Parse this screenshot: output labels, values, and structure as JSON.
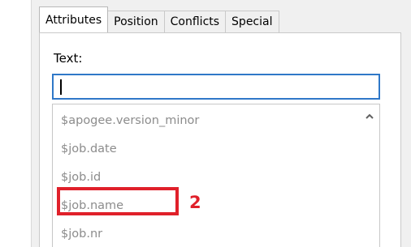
{
  "tabs": [
    {
      "label": "Attributes"
    },
    {
      "label": "Position"
    },
    {
      "label": "Conflicts"
    },
    {
      "label": "Special"
    }
  ],
  "text_field": {
    "label": "Text:",
    "value": ""
  },
  "list": {
    "items": [
      "$apogee.version_minor",
      "$job.date",
      "$job.id",
      "$job.name",
      "$job.nr"
    ]
  },
  "annotation": {
    "number": "2",
    "color": "#e0202a"
  },
  "scroll_icon": "chevron-up-icon"
}
